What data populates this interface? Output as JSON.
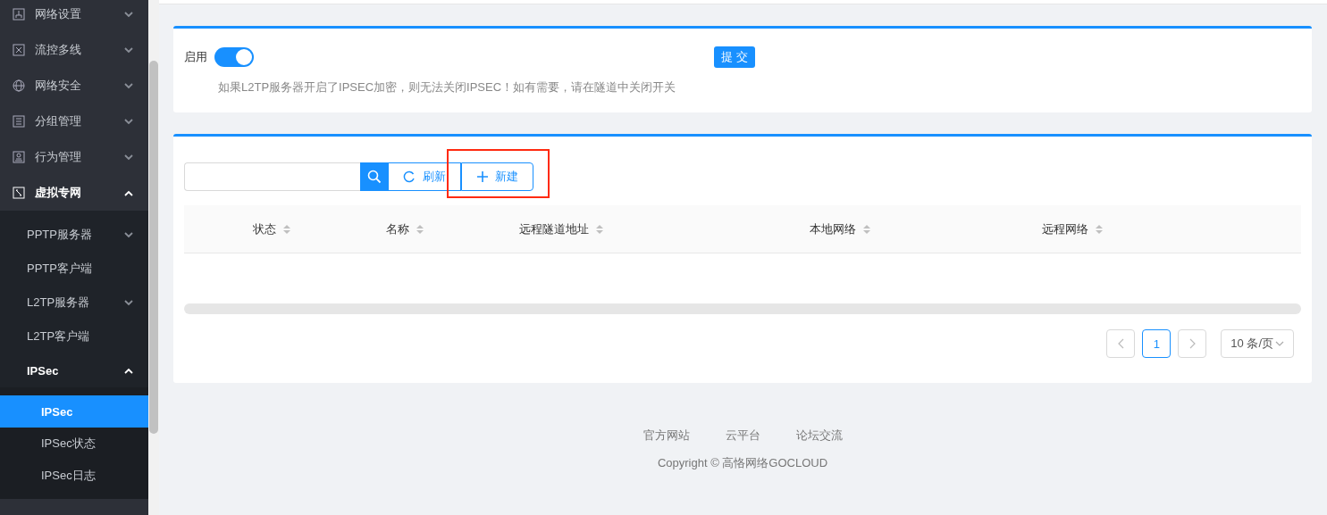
{
  "sidebar": {
    "items": [
      {
        "label": "网络设置",
        "expanded": false
      },
      {
        "label": "流控多线",
        "expanded": false
      },
      {
        "label": "网络安全",
        "expanded": false
      },
      {
        "label": "分组管理",
        "expanded": false
      },
      {
        "label": "行为管理",
        "expanded": false
      },
      {
        "label": "虚拟专网",
        "expanded": true,
        "children": [
          {
            "label": "PPTP服务器",
            "expandable": true,
            "expanded": false
          },
          {
            "label": "PPTP客户端",
            "expandable": false,
            "expanded": false
          },
          {
            "label": "L2TP服务器",
            "expandable": true,
            "expanded": false
          },
          {
            "label": "L2TP客户端",
            "expandable": false,
            "expanded": false
          },
          {
            "label": "IPSec",
            "expandable": true,
            "expanded": true,
            "children": [
              {
                "label": "IPSec",
                "selected": true
              },
              {
                "label": "IPSec状态",
                "selected": false
              },
              {
                "label": "IPSec日志",
                "selected": false
              }
            ]
          }
        ]
      }
    ]
  },
  "settings_card": {
    "enable_label": "启用",
    "enabled": true,
    "submit": "提 交",
    "note": "如果L2TP服务器开启了IPSEC加密，则无法关闭IPSEC！如有需要，请在隧道中关闭开关"
  },
  "list_card": {
    "refresh": "刷新",
    "new": {
      "label": "新建",
      "highlighted": true
    },
    "table": {
      "columns": [
        "状态",
        "名称",
        "远程隧道地址",
        "本地网络",
        "远程网络"
      ]
    },
    "pagination": {
      "pages": [
        {
          "label": "1",
          "selected": true
        }
      ],
      "page_size": "10 条/页"
    }
  },
  "footer": {
    "links": [
      "官方网站",
      "云平台",
      "论坛交流"
    ],
    "copyright": "Copyright © 高恪网络GOCLOUD"
  }
}
